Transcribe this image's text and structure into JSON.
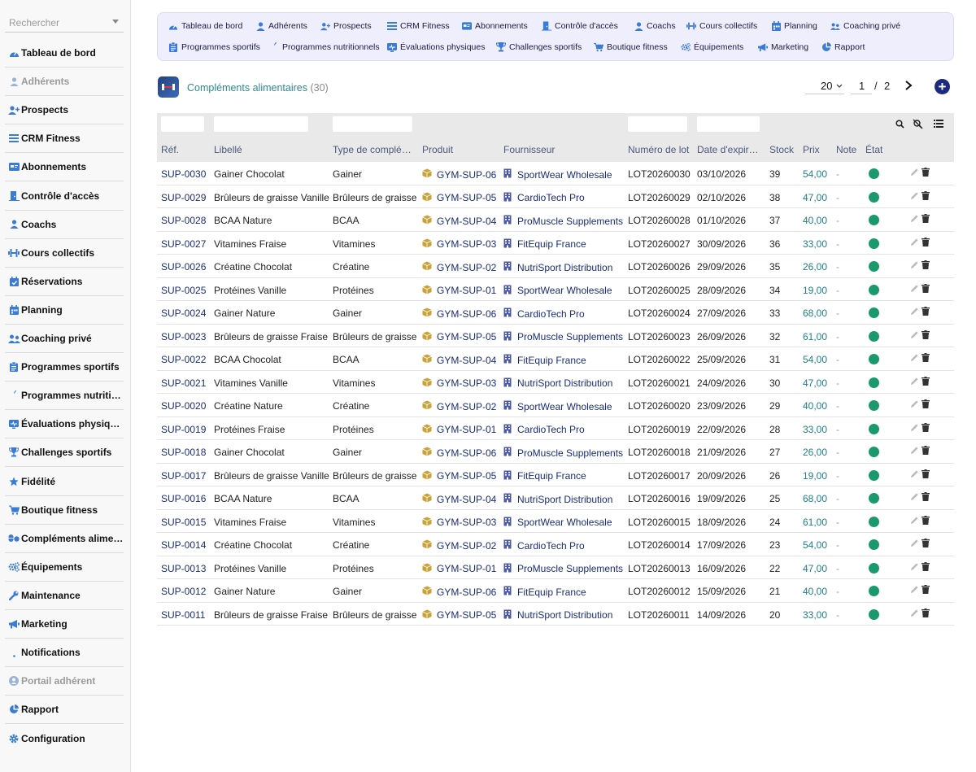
{
  "sidebar": {
    "search_placeholder": "Rechercher",
    "items": [
      {
        "label": "Tableau de bord",
        "icon": "dashboard-icon",
        "disabled": false
      },
      {
        "label": "Adhérents",
        "icon": "user-icon",
        "disabled": true
      },
      {
        "label": "Prospects",
        "icon": "user-plus-icon",
        "disabled": false
      },
      {
        "label": "CRM Fitness",
        "icon": "list-icon",
        "disabled": false
      },
      {
        "label": "Abonnements",
        "icon": "card-icon",
        "disabled": false
      },
      {
        "label": "Contrôle d'accès",
        "icon": "door-icon",
        "disabled": false
      },
      {
        "label": "Coachs",
        "icon": "user-icon",
        "disabled": false
      },
      {
        "label": "Cours collectifs",
        "icon": "dumbbell-icon",
        "disabled": false
      },
      {
        "label": "Réservations",
        "icon": "calendar-check-icon",
        "disabled": false
      },
      {
        "label": "Planning",
        "icon": "calendar-icon",
        "disabled": false
      },
      {
        "label": "Coaching privé",
        "icon": "users-icon",
        "disabled": false
      },
      {
        "label": "Programmes sportifs",
        "icon": "clipboard-icon",
        "disabled": false
      },
      {
        "label": "Programmes nutritionnels",
        "icon": "apple-icon",
        "disabled": false
      },
      {
        "label": "Évaluations physiques",
        "icon": "heart-monitor-icon",
        "disabled": false
      },
      {
        "label": "Challenges sportifs",
        "icon": "trophy-icon",
        "disabled": false
      },
      {
        "label": "Fidélité",
        "icon": "star-icon",
        "disabled": false
      },
      {
        "label": "Boutique fitness",
        "icon": "cart-icon",
        "disabled": false
      },
      {
        "label": "Compléments alimentaires",
        "icon": "pills-icon",
        "disabled": false
      },
      {
        "label": "Équipements",
        "icon": "cogs-icon",
        "disabled": false
      },
      {
        "label": "Maintenance",
        "icon": "wrench-icon",
        "disabled": false
      },
      {
        "label": "Marketing",
        "icon": "megaphone-icon",
        "disabled": false
      },
      {
        "label": "Notifications",
        "icon": "bell-icon",
        "disabled": false
      },
      {
        "label": "Portail adhérent",
        "icon": "user-circle-icon",
        "disabled": true
      },
      {
        "label": "Rapport",
        "icon": "pie-chart-icon",
        "disabled": false
      },
      {
        "label": "Configuration",
        "icon": "gear-icon",
        "disabled": false
      }
    ]
  },
  "topnav": {
    "row1": [
      {
        "label": "Tableau de bord",
        "icon": "dashboard-icon"
      },
      {
        "label": "Adhérents",
        "icon": "user-icon"
      },
      {
        "label": "Prospects",
        "icon": "user-plus-icon"
      },
      {
        "label": "CRM Fitness",
        "icon": "list-icon"
      },
      {
        "label": "Abonnements",
        "icon": "card-icon"
      },
      {
        "label": "Contrôle d'accès",
        "icon": "door-icon"
      },
      {
        "label": "Coachs",
        "icon": "user-icon"
      },
      {
        "label": "Cours collectifs",
        "icon": "dumbbell-icon"
      },
      {
        "label": "Planning",
        "icon": "calendar-icon"
      },
      {
        "label": "Coaching privé",
        "icon": "users-icon"
      }
    ],
    "row2": [
      {
        "label": "Programmes sportifs",
        "icon": "clipboard-icon"
      },
      {
        "label": "Programmes nutritionnels",
        "icon": "apple-icon"
      },
      {
        "label": "Évaluations physiques",
        "icon": "heart-monitor-icon"
      },
      {
        "label": "Challenges sportifs",
        "icon": "trophy-icon"
      },
      {
        "label": "Boutique fitness",
        "icon": "cart-icon"
      },
      {
        "label": "Équipements",
        "icon": "cogs-icon"
      },
      {
        "label": "Marketing",
        "icon": "megaphone-icon"
      },
      {
        "label": "Rapport",
        "icon": "pie-chart-icon"
      }
    ]
  },
  "header": {
    "title": "Compléments alimentaires",
    "count": "(30)",
    "page_size": "20",
    "page_current": "1",
    "page_sep": "/",
    "page_total": "2"
  },
  "table": {
    "columns": [
      "Réf.",
      "Libellé",
      "Type de complé…",
      "Produit",
      "Fournisseur",
      "Numéro de lot",
      "Date d'expir…",
      "Stock",
      "Prix",
      "Note",
      "État"
    ],
    "rows": [
      {
        "ref": "SUP-0030",
        "libelle": "Gainer Chocolat",
        "type": "Gainer",
        "produit": "GYM-SUP-06",
        "fournisseur": "SportWear Wholesale",
        "lot": "LOT20260030",
        "date": "03/10/2026",
        "stock": "39",
        "prix": "54,00",
        "note": "-"
      },
      {
        "ref": "SUP-0029",
        "libelle": "Brûleurs de graisse Vanille",
        "type": "Brûleurs de graisse",
        "produit": "GYM-SUP-05",
        "fournisseur": "CardioTech Pro",
        "lot": "LOT20260029",
        "date": "02/10/2026",
        "stock": "38",
        "prix": "47,00",
        "note": "-"
      },
      {
        "ref": "SUP-0028",
        "libelle": "BCAA Nature",
        "type": "BCAA",
        "produit": "GYM-SUP-04",
        "fournisseur": "ProMuscle Supplements",
        "lot": "LOT20260028",
        "date": "01/10/2026",
        "stock": "37",
        "prix": "40,00",
        "note": "-"
      },
      {
        "ref": "SUP-0027",
        "libelle": "Vitamines Fraise",
        "type": "Vitamines",
        "produit": "GYM-SUP-03",
        "fournisseur": "FitEquip France",
        "lot": "LOT20260027",
        "date": "30/09/2026",
        "stock": "36",
        "prix": "33,00",
        "note": "-"
      },
      {
        "ref": "SUP-0026",
        "libelle": "Créatine Chocolat",
        "type": "Créatine",
        "produit": "GYM-SUP-02",
        "fournisseur": "NutriSport Distribution",
        "lot": "LOT20260026",
        "date": "29/09/2026",
        "stock": "35",
        "prix": "26,00",
        "note": "-"
      },
      {
        "ref": "SUP-0025",
        "libelle": "Protéines Vanille",
        "type": "Protéines",
        "produit": "GYM-SUP-01",
        "fournisseur": "SportWear Wholesale",
        "lot": "LOT20260025",
        "date": "28/09/2026",
        "stock": "34",
        "prix": "19,00",
        "note": "-"
      },
      {
        "ref": "SUP-0024",
        "libelle": "Gainer Nature",
        "type": "Gainer",
        "produit": "GYM-SUP-06",
        "fournisseur": "CardioTech Pro",
        "lot": "LOT20260024",
        "date": "27/09/2026",
        "stock": "33",
        "prix": "68,00",
        "note": "-"
      },
      {
        "ref": "SUP-0023",
        "libelle": "Brûleurs de graisse Fraise",
        "type": "Brûleurs de graisse",
        "produit": "GYM-SUP-05",
        "fournisseur": "ProMuscle Supplements",
        "lot": "LOT20260023",
        "date": "26/09/2026",
        "stock": "32",
        "prix": "61,00",
        "note": "-"
      },
      {
        "ref": "SUP-0022",
        "libelle": "BCAA Chocolat",
        "type": "BCAA",
        "produit": "GYM-SUP-04",
        "fournisseur": "FitEquip France",
        "lot": "LOT20260022",
        "date": "25/09/2026",
        "stock": "31",
        "prix": "54,00",
        "note": "-"
      },
      {
        "ref": "SUP-0021",
        "libelle": "Vitamines Vanille",
        "type": "Vitamines",
        "produit": "GYM-SUP-03",
        "fournisseur": "NutriSport Distribution",
        "lot": "LOT20260021",
        "date": "24/09/2026",
        "stock": "30",
        "prix": "47,00",
        "note": "-"
      },
      {
        "ref": "SUP-0020",
        "libelle": "Créatine Nature",
        "type": "Créatine",
        "produit": "GYM-SUP-02",
        "fournisseur": "SportWear Wholesale",
        "lot": "LOT20260020",
        "date": "23/09/2026",
        "stock": "29",
        "prix": "40,00",
        "note": "-"
      },
      {
        "ref": "SUP-0019",
        "libelle": "Protéines Fraise",
        "type": "Protéines",
        "produit": "GYM-SUP-01",
        "fournisseur": "CardioTech Pro",
        "lot": "LOT20260019",
        "date": "22/09/2026",
        "stock": "28",
        "prix": "33,00",
        "note": "-"
      },
      {
        "ref": "SUP-0018",
        "libelle": "Gainer Chocolat",
        "type": "Gainer",
        "produit": "GYM-SUP-06",
        "fournisseur": "ProMuscle Supplements",
        "lot": "LOT20260018",
        "date": "21/09/2026",
        "stock": "27",
        "prix": "26,00",
        "note": "-"
      },
      {
        "ref": "SUP-0017",
        "libelle": "Brûleurs de graisse Vanille",
        "type": "Brûleurs de graisse",
        "produit": "GYM-SUP-05",
        "fournisseur": "FitEquip France",
        "lot": "LOT20260017",
        "date": "20/09/2026",
        "stock": "26",
        "prix": "19,00",
        "note": "-"
      },
      {
        "ref": "SUP-0016",
        "libelle": "BCAA Nature",
        "type": "BCAA",
        "produit": "GYM-SUP-04",
        "fournisseur": "NutriSport Distribution",
        "lot": "LOT20260016",
        "date": "19/09/2026",
        "stock": "25",
        "prix": "68,00",
        "note": "-"
      },
      {
        "ref": "SUP-0015",
        "libelle": "Vitamines Fraise",
        "type": "Vitamines",
        "produit": "GYM-SUP-03",
        "fournisseur": "SportWear Wholesale",
        "lot": "LOT20260015",
        "date": "18/09/2026",
        "stock": "24",
        "prix": "61,00",
        "note": "-"
      },
      {
        "ref": "SUP-0014",
        "libelle": "Créatine Chocolat",
        "type": "Créatine",
        "produit": "GYM-SUP-02",
        "fournisseur": "CardioTech Pro",
        "lot": "LOT20260014",
        "date": "17/09/2026",
        "stock": "23",
        "prix": "54,00",
        "note": "-"
      },
      {
        "ref": "SUP-0013",
        "libelle": "Protéines Vanille",
        "type": "Protéines",
        "produit": "GYM-SUP-01",
        "fournisseur": "ProMuscle Supplements",
        "lot": "LOT20260013",
        "date": "16/09/2026",
        "stock": "22",
        "prix": "47,00",
        "note": "-"
      },
      {
        "ref": "SUP-0012",
        "libelle": "Gainer Nature",
        "type": "Gainer",
        "produit": "GYM-SUP-06",
        "fournisseur": "FitEquip France",
        "lot": "LOT20260012",
        "date": "15/09/2026",
        "stock": "21",
        "prix": "40,00",
        "note": "-"
      },
      {
        "ref": "SUP-0011",
        "libelle": "Brûleurs de graisse Fraise",
        "type": "Brûleurs de graisse",
        "produit": "GYM-SUP-05",
        "fournisseur": "NutriSport Distribution",
        "lot": "LOT20260011",
        "date": "14/09/2026",
        "stock": "20",
        "prix": "33,00",
        "note": "-"
      }
    ]
  },
  "colors": {
    "accent": "#1b2a80",
    "link": "#1a2d78",
    "price": "#1e7e86",
    "status_ok": "#1a9a6c",
    "icon": "#3a7bd5",
    "product_icon": "#c9a23a"
  }
}
